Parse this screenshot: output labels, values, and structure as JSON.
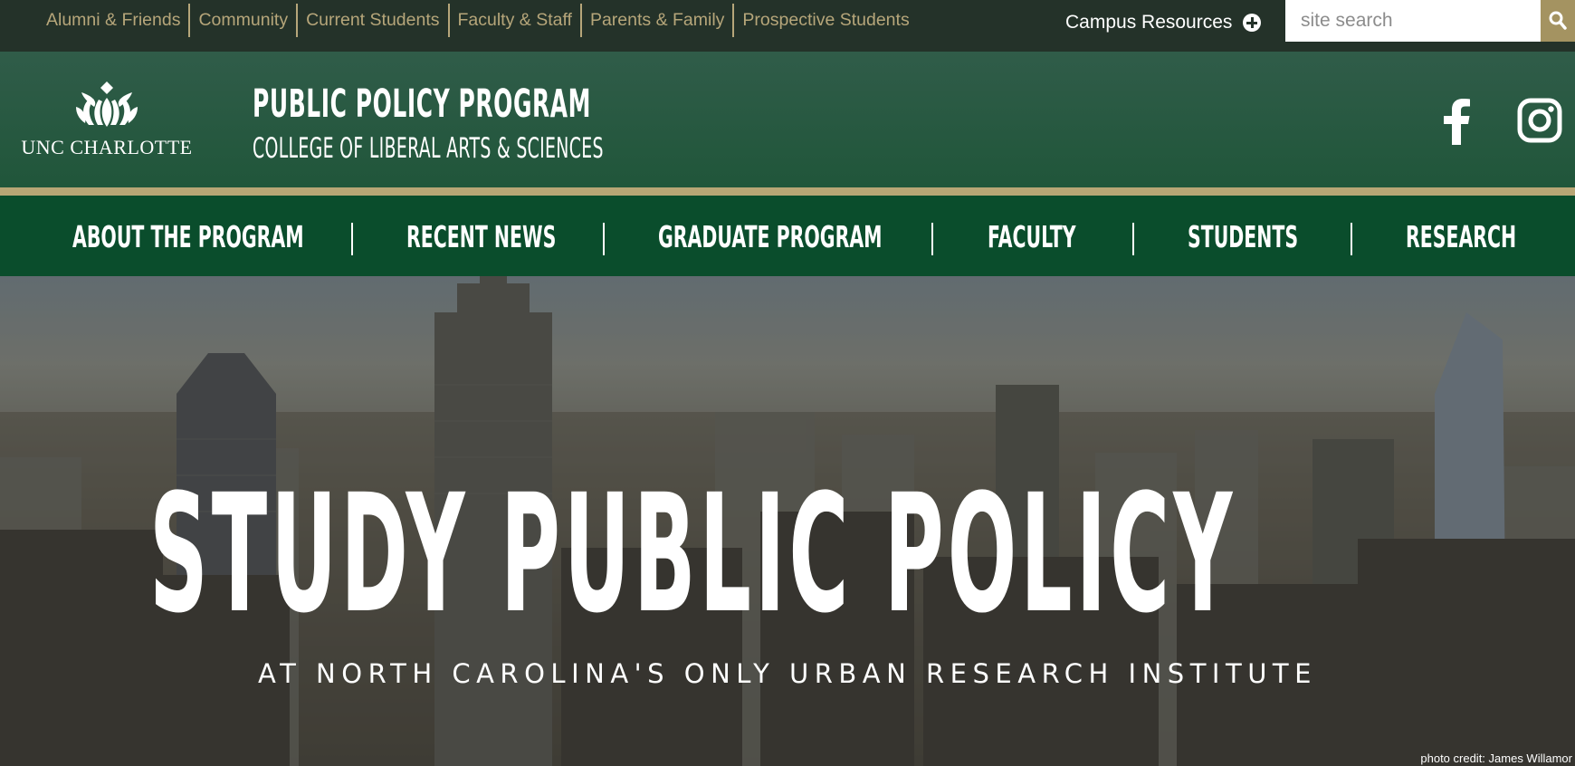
{
  "utility_nav": {
    "links": [
      {
        "label": "Alumni & Friends"
      },
      {
        "label": "Community"
      },
      {
        "label": "Current Students"
      },
      {
        "label": "Faculty & Staff"
      },
      {
        "label": "Parents & Family"
      },
      {
        "label": "Prospective Students"
      }
    ],
    "campus_resources": "Campus Resources",
    "campus_resources_icon": "plus-circle-icon",
    "search": {
      "placeholder": "site search",
      "button_icon": "search-icon"
    }
  },
  "header": {
    "logo_text": "UNC CHARLOTTE",
    "title": "PUBLIC POLICY PROGRAM",
    "subtitle": "COLLEGE OF LIBERAL ARTS & SCIENCES",
    "social": [
      {
        "name": "facebook-icon"
      },
      {
        "name": "instagram-icon"
      }
    ]
  },
  "main_nav": {
    "items": [
      {
        "label": "ABOUT THE PROGRAM"
      },
      {
        "label": "RECENT NEWS"
      },
      {
        "label": "GRADUATE PROGRAM"
      },
      {
        "label": "FACULTY"
      },
      {
        "label": "STUDENTS"
      },
      {
        "label": "RESEARCH"
      }
    ]
  },
  "hero": {
    "headline": "STUDY PUBLIC POLICY",
    "subheadline": "AT NORTH CAROLINA'S ONLY URBAN RESEARCH INSTITUTE",
    "photo_credit": "photo credit: James Willamor"
  },
  "colors": {
    "utility_bar": "#243229",
    "utility_link": "#b6a67a",
    "header_green": "#20563a",
    "gold": "#b8a675",
    "nav_green": "#0a4d2c",
    "search_button": "#a49361"
  }
}
